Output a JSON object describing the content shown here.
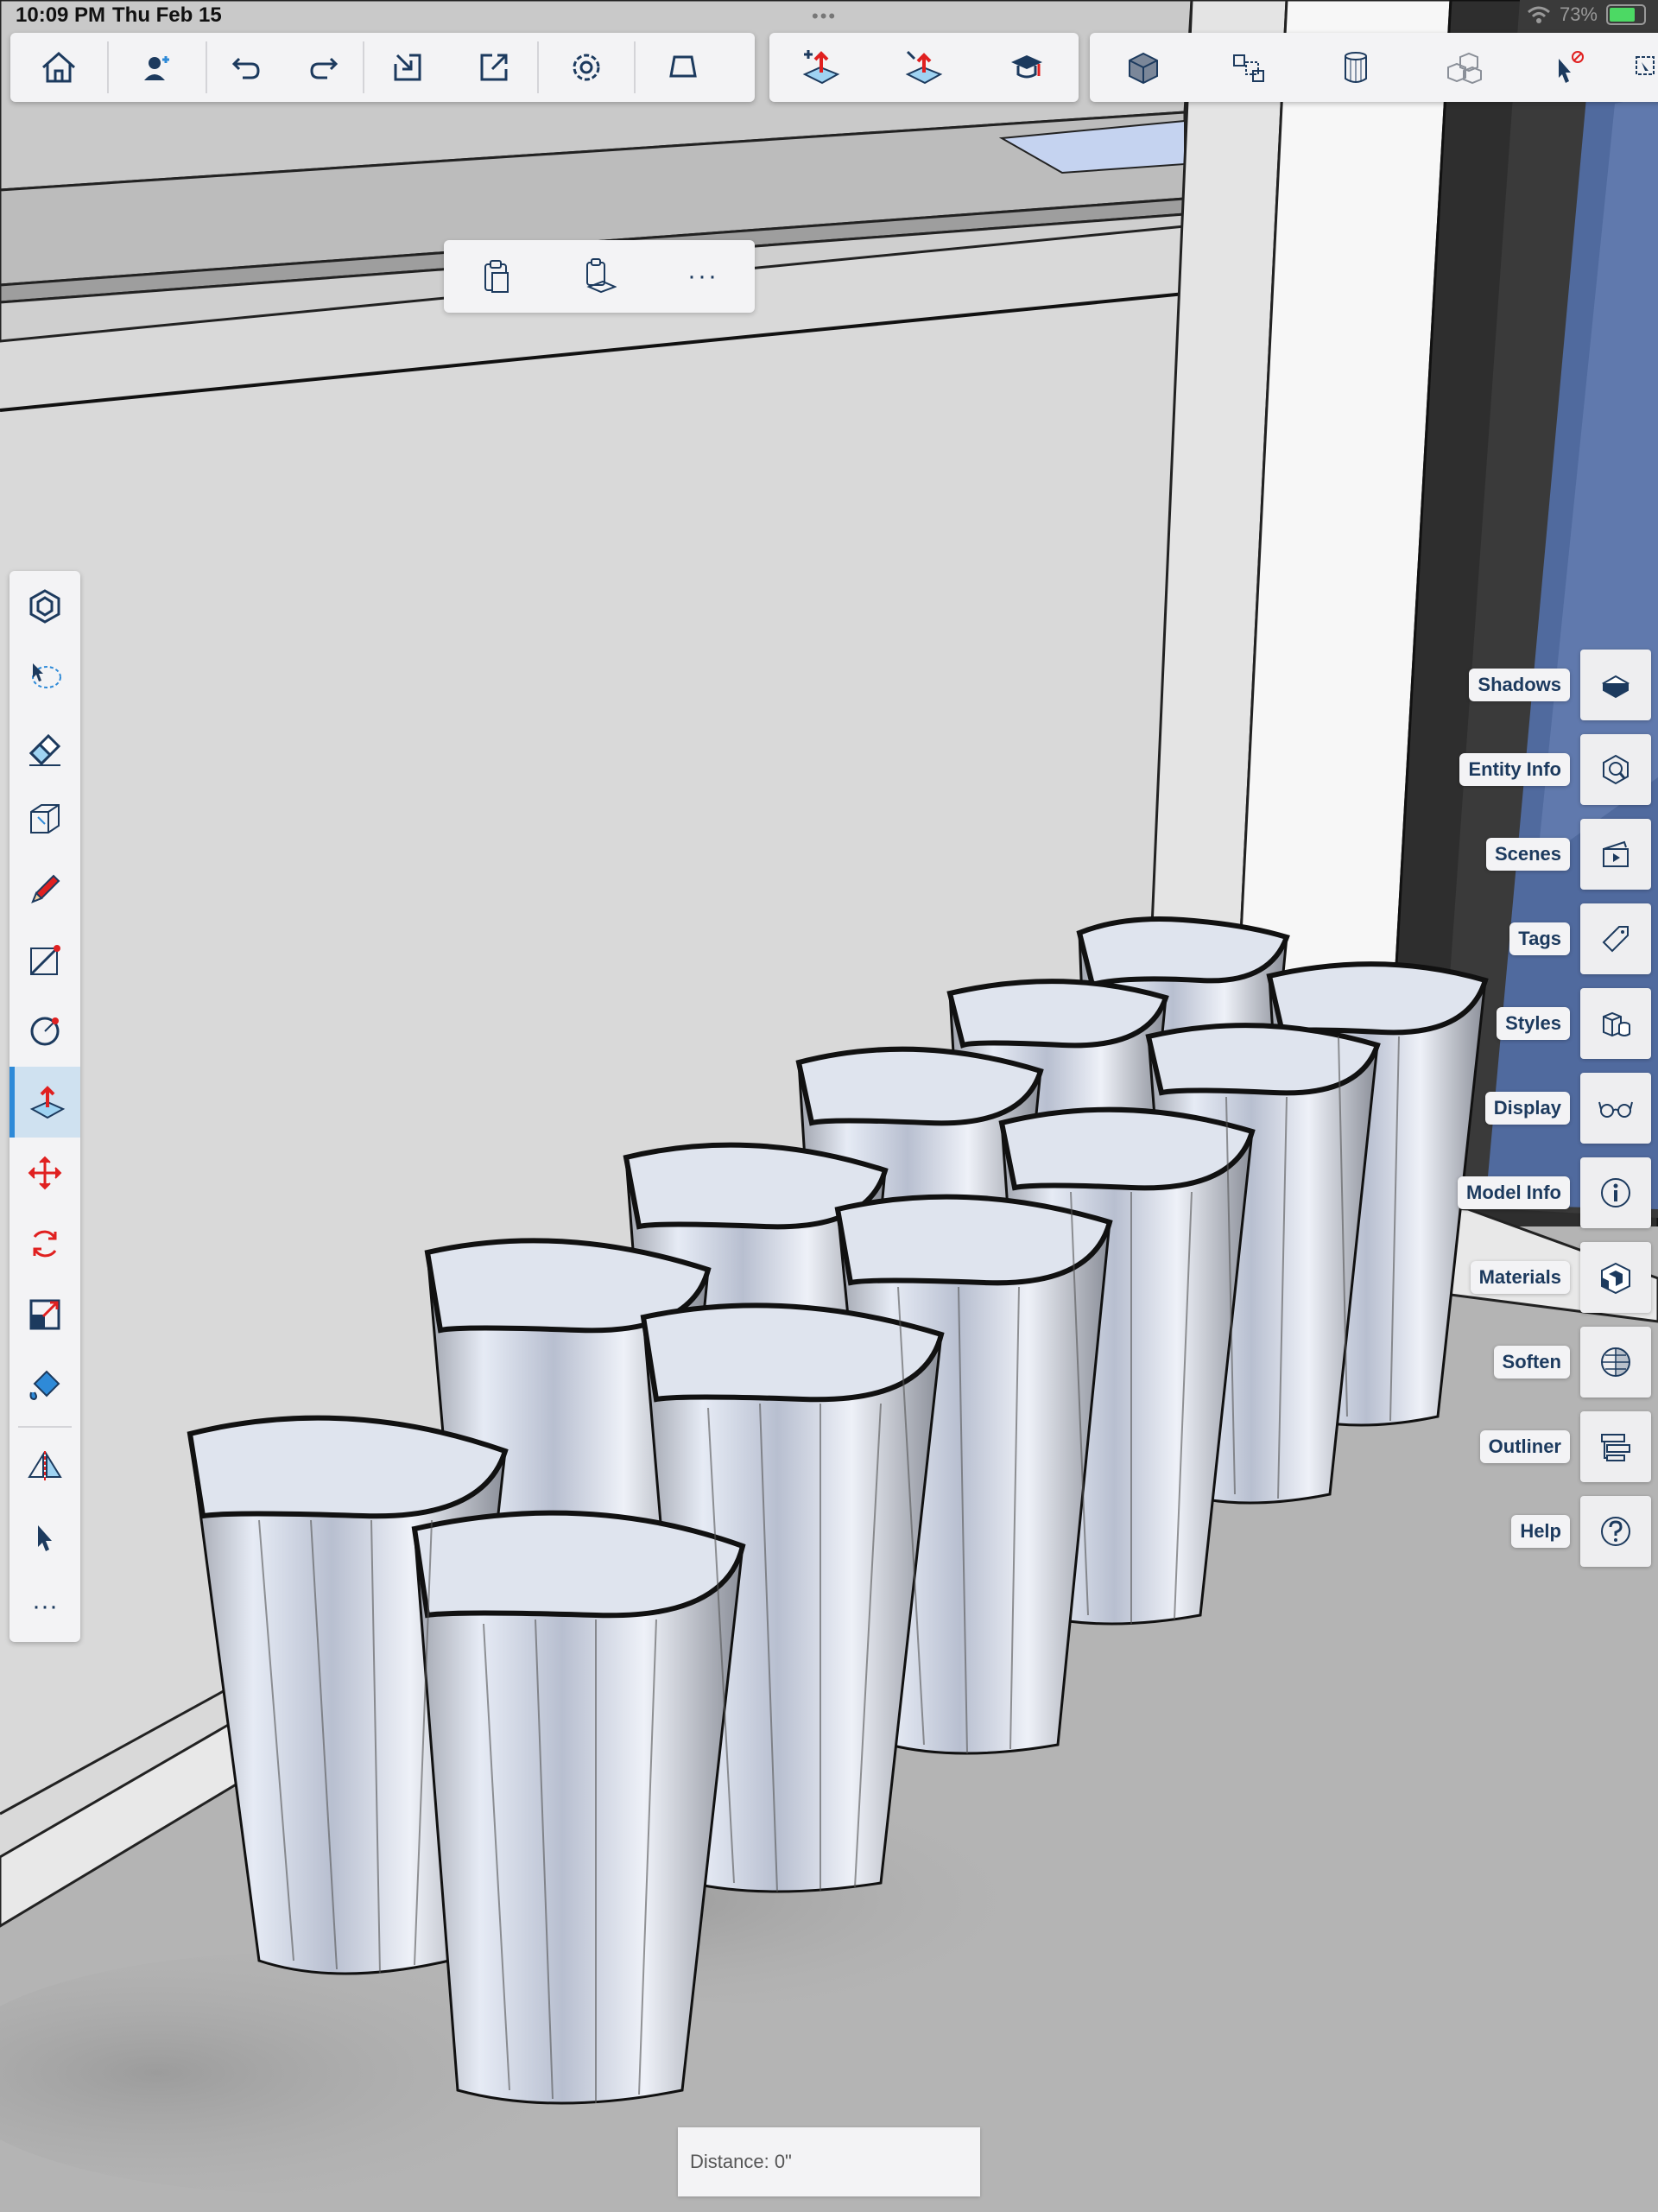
{
  "status_bar": {
    "time": "10:09 PM",
    "date": "Thu Feb 15",
    "multitask_indicator": "•••",
    "battery_percent": "73%",
    "icons": [
      "wifi-icon",
      "battery-icon"
    ]
  },
  "toolbar_main": {
    "buttons": [
      "home",
      "collaborate",
      "undo",
      "redo",
      "import",
      "export",
      "settings",
      "view-mode"
    ]
  },
  "toolbar_tools": {
    "buttons": [
      "push-pull-add",
      "push-pull-remove",
      "instructor"
    ]
  },
  "toolbar_views": {
    "buttons": [
      "solid-view",
      "components",
      "cylinder-view",
      "boxes-view",
      "select-disabled",
      "more"
    ]
  },
  "context_menu": {
    "buttons": [
      "paste",
      "paste-in-place"
    ],
    "more_label": "···"
  },
  "left_tools": {
    "active": "push-pull",
    "items": [
      "orbit",
      "lasso-select",
      "eraser",
      "tape-measure",
      "pencil",
      "line",
      "circle",
      "push-pull",
      "move",
      "rotate",
      "scale",
      "paint-bucket",
      "section-plane",
      "select"
    ],
    "more_label": "···"
  },
  "right_panels": [
    {
      "label": "Shadows",
      "icon": "shadows-icon"
    },
    {
      "label": "Entity Info",
      "icon": "entity-info-icon"
    },
    {
      "label": "Scenes",
      "icon": "scenes-icon"
    },
    {
      "label": "Tags",
      "icon": "tag-icon"
    },
    {
      "label": "Styles",
      "icon": "styles-icon"
    },
    {
      "label": "Display",
      "icon": "glasses-icon"
    },
    {
      "label": "Model Info",
      "icon": "info-icon"
    },
    {
      "label": "Materials",
      "icon": "materials-icon"
    },
    {
      "label": "Soften",
      "icon": "soften-icon"
    },
    {
      "label": "Outliner",
      "icon": "outliner-icon"
    },
    {
      "label": "Help",
      "icon": "help-icon"
    }
  ],
  "measurement": {
    "text": "Distance: 0\""
  },
  "colors": {
    "icon": "#1c3a5e",
    "accent_red": "#e02020",
    "accent_blue": "#2e8ad8",
    "toolbar_bg": "#f3f3f5"
  }
}
